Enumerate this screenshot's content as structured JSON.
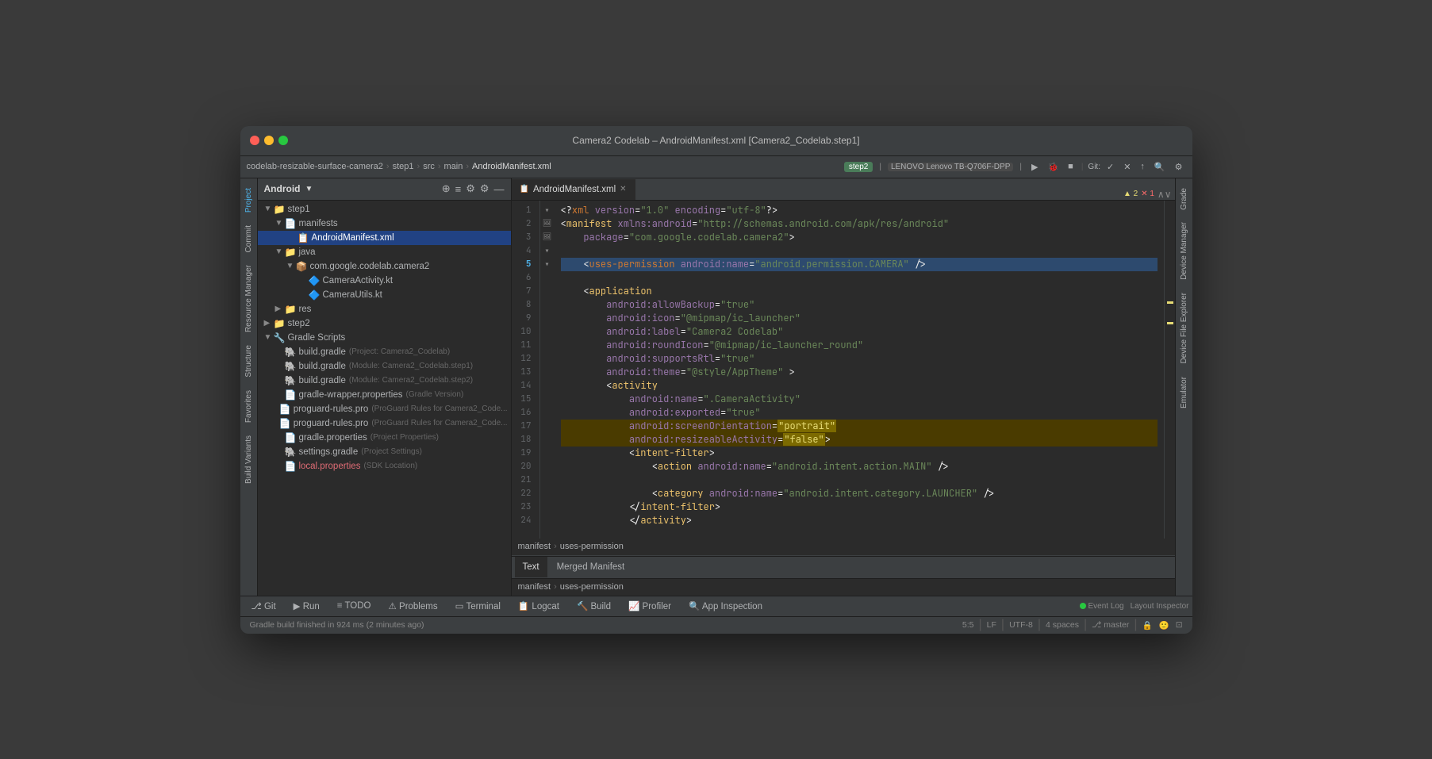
{
  "window": {
    "title": "Camera2 Codelab – AndroidManifest.xml [Camera2_Codelab.step1]",
    "traffic_lights": [
      "close",
      "minimize",
      "maximize"
    ]
  },
  "breadcrumb": {
    "items": [
      "codelab-resizable-surface-camera2",
      "step1",
      "src",
      "main",
      "AndroidManifest.xml"
    ],
    "run_config": "step2",
    "device": "LENOVO Lenovo TB-Q706F-DPP",
    "git_label": "Git:"
  },
  "project_panel": {
    "title": "Android",
    "tree": [
      {
        "id": "step1",
        "label": "step1",
        "type": "folder",
        "indent": 0,
        "expanded": true
      },
      {
        "id": "manifests",
        "label": "manifests",
        "type": "folder",
        "indent": 1,
        "expanded": true
      },
      {
        "id": "androidmanifest",
        "label": "AndroidManifest.xml",
        "type": "xml",
        "indent": 2,
        "selected": true
      },
      {
        "id": "java",
        "label": "java",
        "type": "folder",
        "indent": 1,
        "expanded": true
      },
      {
        "id": "package",
        "label": "com.google.codelab.camera2",
        "type": "package",
        "indent": 2,
        "expanded": true
      },
      {
        "id": "cameraactivity",
        "label": "CameraActivity.kt",
        "type": "kt",
        "indent": 3
      },
      {
        "id": "camerautils",
        "label": "CameraUtils.kt",
        "type": "kt",
        "indent": 3
      },
      {
        "id": "res",
        "label": "res",
        "type": "folder",
        "indent": 1,
        "expanded": false
      },
      {
        "id": "step2",
        "label": "step2",
        "type": "folder",
        "indent": 0,
        "expanded": false
      },
      {
        "id": "gradle_scripts",
        "label": "Gradle Scripts",
        "type": "gradle_folder",
        "indent": 0,
        "expanded": true
      },
      {
        "id": "build_gradle_project",
        "label": "build.gradle",
        "type": "gradle",
        "hint": "(Project: Camera2_Codelab)",
        "indent": 1
      },
      {
        "id": "build_gradle_step1",
        "label": "build.gradle",
        "type": "gradle",
        "hint": "(Module: Camera2_Codelab.step1)",
        "indent": 1
      },
      {
        "id": "build_gradle_step2",
        "label": "build.gradle",
        "type": "gradle",
        "hint": "(Module: Camera2_Codelab.step2)",
        "indent": 1
      },
      {
        "id": "gradle_wrapper",
        "label": "gradle-wrapper.properties",
        "type": "properties",
        "hint": "(Gradle Version)",
        "indent": 1
      },
      {
        "id": "proguard1",
        "label": "proguard-rules.pro",
        "type": "proguard",
        "hint": "(ProGuard Rules for Camera2_Code...",
        "indent": 1
      },
      {
        "id": "proguard2",
        "label": "proguard-rules.pro",
        "type": "proguard",
        "hint": "(ProGuard Rules for Camera2_Code...",
        "indent": 1
      },
      {
        "id": "gradle_properties",
        "label": "gradle.properties",
        "type": "properties",
        "hint": "(Project Properties)",
        "indent": 1
      },
      {
        "id": "settings_gradle",
        "label": "settings.gradle",
        "type": "gradle",
        "hint": "(Project Settings)",
        "indent": 1
      },
      {
        "id": "local_properties",
        "label": "local.properties",
        "type": "properties",
        "hint": "(SDK Location)",
        "indent": 1
      }
    ]
  },
  "editor": {
    "tabs": [
      {
        "label": "AndroidManifest.xml",
        "active": true,
        "closeable": true
      }
    ],
    "breadcrumb": [
      "manifest",
      "uses-permission"
    ],
    "warning_count": "▲ 2",
    "error_count": "✕ 1",
    "lines": [
      {
        "num": 1,
        "code": "<?xml version=\"1.0\" encoding=\"utf-8\"?>",
        "gutter": ""
      },
      {
        "num": 2,
        "code": "<manifest xmlns:android=\"http://schemas.android.com/apk/res/android\"",
        "gutter": ""
      },
      {
        "num": 3,
        "code": "    package=\"com.google.codelab.camera2\">",
        "gutter": ""
      },
      {
        "num": 4,
        "code": "",
        "gutter": ""
      },
      {
        "num": 5,
        "code": "    <uses-permission android:name=\"android.permission.CAMERA\" />",
        "gutter": "",
        "highlight": "current"
      },
      {
        "num": 6,
        "code": "",
        "gutter": ""
      },
      {
        "num": 7,
        "code": "    <application",
        "gutter": "fold"
      },
      {
        "num": 8,
        "code": "        android:allowBackup=\"true\"",
        "gutter": ""
      },
      {
        "num": 9,
        "code": "        android:icon=\"@mipmap/ic_launcher\"",
        "gutter": "img"
      },
      {
        "num": 10,
        "code": "        android:label=\"Camera2 Codelab\"",
        "gutter": ""
      },
      {
        "num": 11,
        "code": "        android:roundIcon=\"@mipmap/ic_launcher_round\"",
        "gutter": "img"
      },
      {
        "num": 12,
        "code": "        android:supportsRtl=\"true\"",
        "gutter": ""
      },
      {
        "num": 13,
        "code": "        android:theme=\"@style/AppTheme\" >",
        "gutter": ""
      },
      {
        "num": 14,
        "code": "        <activity",
        "gutter": "fold"
      },
      {
        "num": 15,
        "code": "            android:name=\".CameraActivity\"",
        "gutter": ""
      },
      {
        "num": 16,
        "code": "            android:exported=\"true\"",
        "gutter": ""
      },
      {
        "num": 17,
        "code": "            android:screenOrientation=\"portrait\"",
        "gutter": "",
        "highlight": "warn"
      },
      {
        "num": 18,
        "code": "            android:resizeableActivity=\"false\">",
        "gutter": "",
        "highlight": "warn"
      },
      {
        "num": 19,
        "code": "            <intent-filter>",
        "gutter": "fold"
      },
      {
        "num": 20,
        "code": "                <action android:name=\"android.intent.action.MAIN\" />",
        "gutter": ""
      },
      {
        "num": 21,
        "code": "",
        "gutter": ""
      },
      {
        "num": 22,
        "code": "                <category android:name=\"android.intent.category.LAUNCHER\" />",
        "gutter": ""
      },
      {
        "num": 23,
        "code": "            </intent-filter>",
        "gutter": ""
      },
      {
        "num": 24,
        "code": "            </activity>",
        "gutter": ""
      }
    ]
  },
  "bottom_panel": {
    "tabs": [
      "Text",
      "Merged Manifest"
    ],
    "active_tab": "Text",
    "path_items": [
      "manifest",
      "uses-permission"
    ]
  },
  "bottom_tabs_main": [
    {
      "label": "Git",
      "icon": "git"
    },
    {
      "label": "Run",
      "icon": "play"
    },
    {
      "label": "TODO",
      "icon": "list"
    },
    {
      "label": "Problems",
      "icon": "warning"
    },
    {
      "label": "Terminal",
      "icon": "terminal"
    },
    {
      "label": "Logcat",
      "icon": "log"
    },
    {
      "label": "Build",
      "icon": "build"
    },
    {
      "label": "Profiler",
      "icon": "profile"
    },
    {
      "label": "App Inspection",
      "icon": "inspect"
    }
  ],
  "right_tabs": [
    {
      "label": "Grade"
    },
    {
      "label": "Device Manager"
    },
    {
      "label": "Device File Explorer"
    },
    {
      "label": "Emulator"
    }
  ],
  "left_side_tabs": [
    {
      "label": "Project"
    },
    {
      "label": "Commit"
    },
    {
      "label": "Resource Manager"
    },
    {
      "label": "Structure"
    },
    {
      "label": "Favorites"
    },
    {
      "label": "Build Variants"
    }
  ],
  "status_bar": {
    "git_icon": "⎇",
    "branch": "master",
    "position": "5:5",
    "line_ending": "LF",
    "encoding": "UTF-8",
    "indent": "4 spaces",
    "event_log": "Event Log",
    "layout_inspector": "Layout Inspector",
    "build_status": "Gradle build finished in 924 ms (2 minutes ago)"
  }
}
